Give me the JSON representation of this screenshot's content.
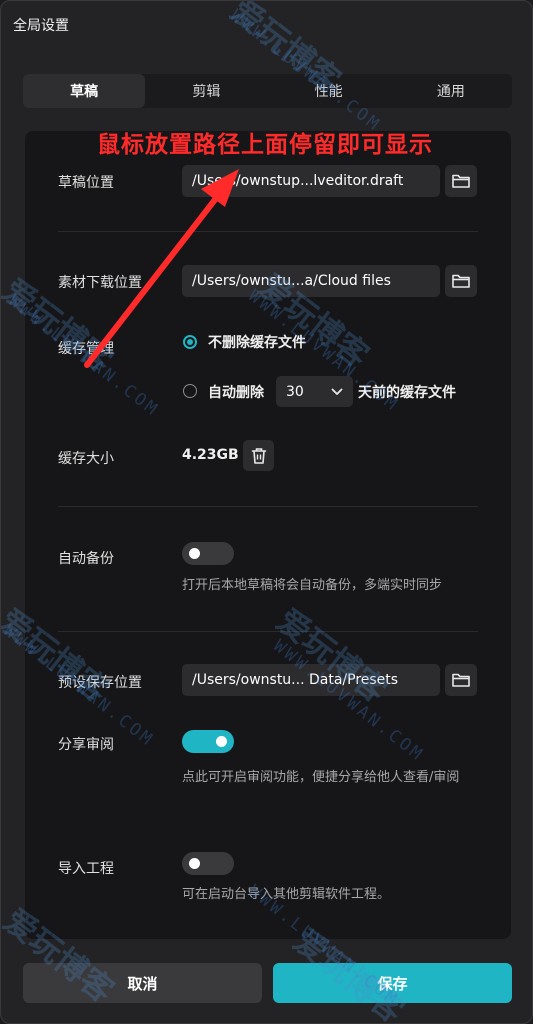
{
  "window": {
    "title": "全局设置"
  },
  "tabs": [
    {
      "label": "草稿",
      "active": true
    },
    {
      "label": "剪辑",
      "active": false
    },
    {
      "label": "性能",
      "active": false
    },
    {
      "label": "通用",
      "active": false
    }
  ],
  "annotation": {
    "text": "鼠标放置路径上面停留即可显示",
    "color": "#ff2a2a"
  },
  "draft_location": {
    "label": "草稿位置",
    "path": "/Users/ownstup...lveditor.draft"
  },
  "material_location": {
    "label": "素材下载位置",
    "path": "/Users/ownstu...a/Cloud files"
  },
  "cache_management": {
    "label": "缓存管理",
    "option_keep": "不删除缓存文件",
    "option_auto_prefix": "自动删除",
    "days_value": "30",
    "option_auto_suffix": "天前的缓存文件",
    "selected": "keep"
  },
  "cache_size": {
    "label": "缓存大小",
    "value": "4.23GB"
  },
  "auto_backup": {
    "label": "自动备份",
    "enabled": false,
    "hint": "打开后本地草稿将会自动备份，多端实时同步"
  },
  "preset_location": {
    "label": "预设保存位置",
    "path": "/Users/ownstu... Data/Presets"
  },
  "share_review": {
    "label": "分享审阅",
    "enabled": true,
    "hint": "点此可开启审阅功能，便捷分享给他人查看/审阅"
  },
  "import_project": {
    "label": "导入工程",
    "enabled": false,
    "hint": "可在启动台导入其他剪辑软件工程。"
  },
  "footer": {
    "cancel_label": "取消",
    "save_label": "保存"
  },
  "watermark": {
    "text": "爱玩博客",
    "url": "WWW.LUVWAN.COM"
  },
  "colors": {
    "accent": "#1fb5c4",
    "background": "#232325",
    "panel": "#161618"
  },
  "icons": {
    "folder": "folder-icon",
    "trash": "trash-icon",
    "chevron": "chevron-down-icon"
  }
}
